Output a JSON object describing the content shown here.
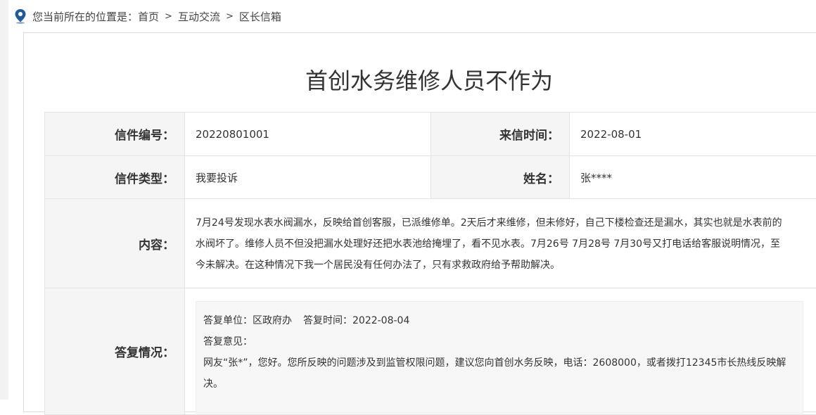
{
  "breadcrumb": {
    "prefix": "您当前所在的位置是：",
    "items": [
      "首页",
      "互动交流",
      "区长信箱"
    ],
    "separator": ">"
  },
  "title": "首创水务维修人员不作为",
  "fields": {
    "number_label": "信件编号：",
    "number": "20220801001",
    "date_label": "来信时间：",
    "date": "2022-08-01",
    "type_label": "信件类型：",
    "type": "我要投诉",
    "name_label": "姓名：",
    "name": "张****",
    "content_label": "内容：",
    "content": "7月24号发现水表水阀漏水，反映给首创客服，已派维修单。2天后才来维修，但未修好，自己下楼检查还是漏水，其实也就是水表前的水阀坏了。维修人员不但没把漏水处理好还把水表池给掩埋了，看不见水表。7月26号 7月28号 7月30号又打电话给客服说明情况，至今未解决。在这种情况下我一个居民没有任何办法了，只有求救政府给予帮助解决。",
    "reply_label": "答复情况："
  },
  "reply": {
    "unit": "答复单位：区政府办",
    "time": "答复时间：2022-08-04",
    "opinion_label": "答复意见：",
    "text": "网友“张*”，您好。您所反映的问题涉及到监管权限问题，建议您向首创水务反映，电话：2608000，或者拨打12345市长热线反映解决。"
  }
}
